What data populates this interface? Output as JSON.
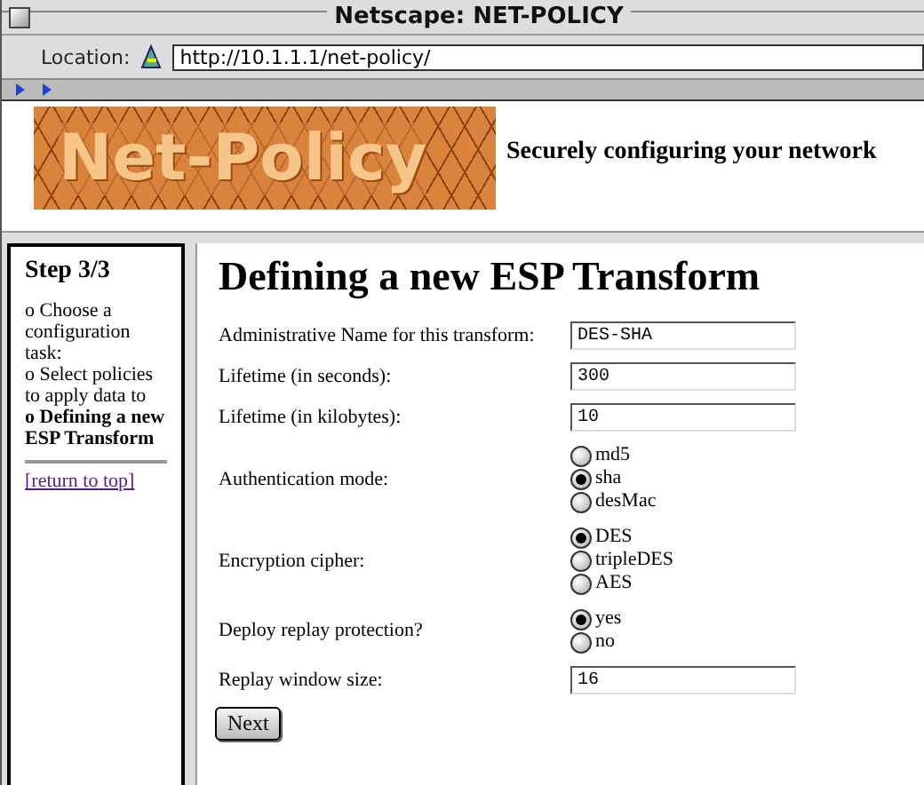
{
  "window": {
    "title": "Netscape: NET-POLICY"
  },
  "location": {
    "label": "Location:",
    "url": "http://10.1.1.1/net-policy/"
  },
  "banner": {
    "logo_text": "Net-Policy",
    "tagline": "Securely configuring your network"
  },
  "sidebar": {
    "step": "Step 3/3",
    "items": [
      {
        "text": "o Choose a configuration task:",
        "current": false
      },
      {
        "text": "o Select policies to apply data to",
        "current": false
      },
      {
        "text": "o Defining a new ESP Transform",
        "current": true
      }
    ],
    "link": "[return to top]"
  },
  "form": {
    "heading": "Defining a new ESP Transform",
    "rows": [
      {
        "kind": "text",
        "label": "Administrative Name for this transform:",
        "value": "DES-SHA"
      },
      {
        "kind": "text",
        "label": "Lifetime (in seconds):",
        "value": "300"
      },
      {
        "kind": "text",
        "label": "Lifetime (in kilobytes):",
        "value": "10"
      },
      {
        "kind": "radio",
        "label": "Authentication mode:",
        "options": [
          {
            "label": "md5",
            "selected": false
          },
          {
            "label": "sha",
            "selected": true
          },
          {
            "label": "desMac",
            "selected": false
          }
        ]
      },
      {
        "kind": "radio",
        "label": "Encryption cipher:",
        "options": [
          {
            "label": "DES",
            "selected": true
          },
          {
            "label": "tripleDES",
            "selected": false
          },
          {
            "label": "AES",
            "selected": false
          }
        ]
      },
      {
        "kind": "radio",
        "label": "Deploy replay protection?",
        "options": [
          {
            "label": "yes",
            "selected": true
          },
          {
            "label": "no",
            "selected": false
          }
        ]
      },
      {
        "kind": "text",
        "label": "Replay window size:",
        "value": "16"
      }
    ],
    "submit": "Next"
  }
}
